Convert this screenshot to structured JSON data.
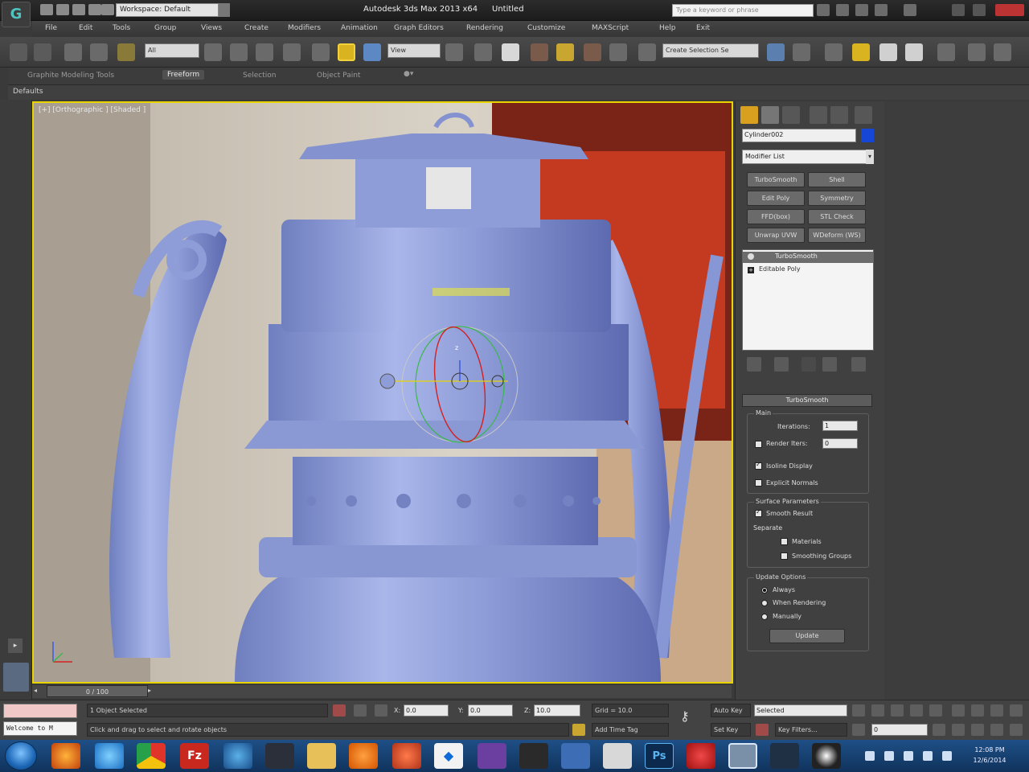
{
  "titlebar": {
    "workspace": "Workspace: Default",
    "app_title": "Autodesk 3ds Max 2013 x64",
    "file_title": "Untitled",
    "search_placeholder": "Type a keyword or phrase"
  },
  "menu": [
    "File",
    "Edit",
    "Tools",
    "Group",
    "Views",
    "Create",
    "Modifiers",
    "Animation",
    "Graph Editors",
    "Rendering",
    "Customize",
    "MAXScript",
    "Help",
    "Exit"
  ],
  "toolbar": {
    "selection_filter": "All",
    "reference_coord": "View",
    "named_selection": "Create Selection Se"
  },
  "ribbon": {
    "tabs": [
      "Graphite Modeling Tools",
      "Freeform",
      "Selection",
      "Object Paint"
    ],
    "active_tab": "Freeform",
    "defaults_label": "Defaults"
  },
  "viewport": {
    "label": "[+] [Orthographic ] [Shaded ]",
    "gizmo_axis": "z"
  },
  "command_panel": {
    "object_name": "Cylinder002",
    "object_color": "#1646d6",
    "modifier_list": "Modifier List",
    "modifier_buttons": [
      "TurboSmooth",
      "Shell",
      "Edit Poly",
      "Symmetry",
      "FFD(box)",
      "STL Check",
      "Unwrap UVW",
      "WDeform (WS)"
    ],
    "stack": {
      "selected": "TurboSmooth",
      "base": "Editable Poly"
    },
    "rollout": {
      "title": "TurboSmooth",
      "main_group": "Main",
      "iterations_label": "Iterations:",
      "iterations_value": "1",
      "render_iters_label": "Render Iters:",
      "render_iters_value": "0",
      "isoline_display": "Isoline Display",
      "explicit_normals": "Explicit Normals",
      "surface_group": "Surface Parameters",
      "smooth_result": "Smooth Result",
      "separate_label": "Separate",
      "materials": "Materials",
      "smoothing_groups": "Smoothing Groups",
      "update_group": "Update Options",
      "always": "Always",
      "when_rendering": "When Rendering",
      "manually": "Manually",
      "update_button": "Update"
    }
  },
  "timeline": {
    "frame": "0 / 100"
  },
  "statusbar": {
    "listener": "Welcome to M",
    "selection_status": "1 Object Selected",
    "prompt": "Click and drag to select and rotate objects",
    "x_value": "0.0",
    "y_value": "0.0",
    "z_value": "10.0",
    "grid": "Grid = 10.0",
    "add_time_tag": "Add Time Tag",
    "auto_key": "Auto Key",
    "set_key": "Set Key",
    "selected_option": "Selected",
    "key_filters": "Key Filters...",
    "current_frame": "0"
  },
  "taskbar": {
    "time": "12:08 PM",
    "date": "12/6/2014"
  }
}
